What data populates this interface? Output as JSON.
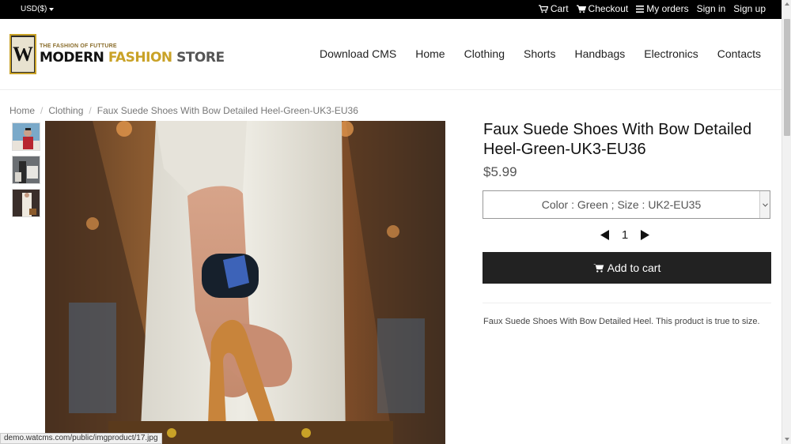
{
  "topbar": {
    "currency": "USD($)",
    "links": [
      {
        "label": "Cart",
        "icon": "cart-icon"
      },
      {
        "label": "Checkout",
        "icon": "cart-icon"
      },
      {
        "label": "My orders",
        "icon": "menu-icon"
      },
      {
        "label": "Sign in",
        "icon": ""
      },
      {
        "label": "Sign up",
        "icon": ""
      }
    ]
  },
  "logo": {
    "letter": "W",
    "tagline": "THE FASHION OF FUTTURE",
    "name_part1": "MODERN",
    "name_part2": "FASHION",
    "name_part3": "STORE"
  },
  "nav": [
    "Download CMS",
    "Home",
    "Clothing",
    "Shorts",
    "Handbags",
    "Electronics",
    "Contacts"
  ],
  "breadcrumb": [
    "Home",
    "Clothing",
    "Faux Suede Shoes With Bow Detailed Heel-Green-UK3-EU36"
  ],
  "product": {
    "title": "Faux Suede Shoes With Bow Detailed Heel-Green-UK3-EU36",
    "price": "$5.99",
    "variant": "Color : Green ; Size : UK2-EU35",
    "quantity": "1",
    "add_to_cart": "Add to cart",
    "description": "Faux Suede Shoes With Bow Detailed Heel. This product is true to size."
  },
  "status_url": "demo.watcms.com/public/imgproduct/17.jpg",
  "colors": {
    "topbar": "#000000",
    "button": "#222222",
    "logo_gold": "#c9a227"
  }
}
